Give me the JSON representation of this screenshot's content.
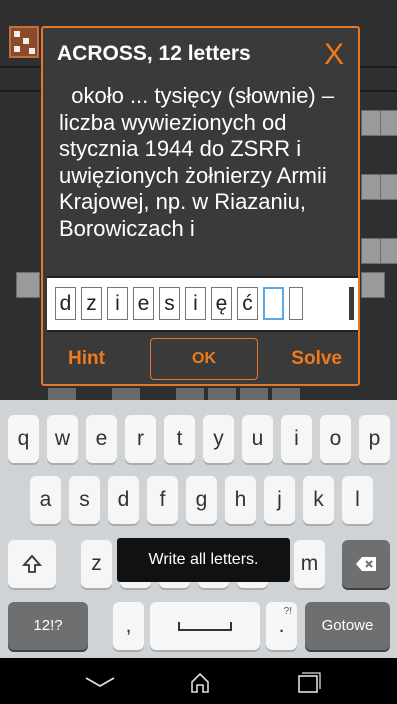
{
  "dialog": {
    "title": "ACROSS, 12 letters",
    "close_label": "X",
    "clue": "  około ... tysięcy (słownie) – liczba wywiezionych od stycznia 1944 do ZSRR i uwięzionych żołnierzy Armii Krajowej, np. w Riazaniu, Borowiczach i",
    "answer_letters": [
      "d",
      "z",
      "i",
      "e",
      "s",
      "i",
      "ę",
      "ć",
      "",
      ""
    ],
    "hint_label": "Hint",
    "ok_label": "OK",
    "solve_label": "Solve"
  },
  "keyboard": {
    "row1": [
      "q",
      "w",
      "e",
      "r",
      "t",
      "y",
      "u",
      "i",
      "o",
      "p"
    ],
    "row2": [
      "a",
      "s",
      "d",
      "f",
      "g",
      "h",
      "j",
      "k",
      "l"
    ],
    "row3_left": "z",
    "row3_right": "m",
    "symbols_label": "12!?",
    "comma": ",",
    "period": ".",
    "period_super": "?!",
    "done_label": "Gotowe",
    "shift_icon": "shift-icon",
    "backspace_icon": "backspace-icon"
  },
  "toast": {
    "text": "Write all letters."
  },
  "navbar": {
    "back_icon": "back-icon",
    "home_icon": "home-icon",
    "recents_icon": "recents-icon"
  },
  "colors": {
    "accent": "#f07a1c",
    "dialog_bg": "#3a3a3a",
    "keyboard_bg": "#cfd3d6",
    "active_box": "#5aa9e6"
  }
}
